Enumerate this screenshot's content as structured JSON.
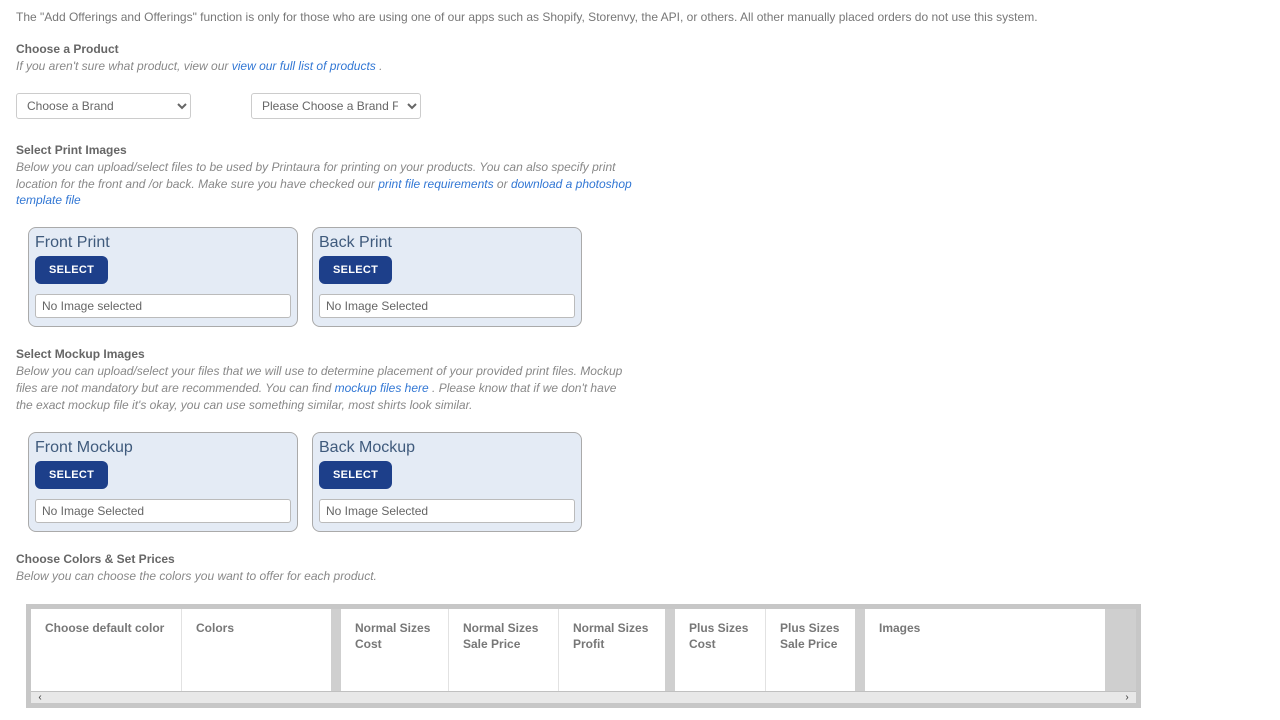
{
  "intro": "The \"Add Offerings and Offerings\" function is only for those who are using one of our apps such as Shopify, Storenvy, the API, or others. All other manually placed orders do not use this system.",
  "product": {
    "title": "Choose a Product",
    "sub_prefix": "If you aren't sure what product, view our ",
    "link": "view our full list of products",
    "sub_suffix": " ."
  },
  "selects": {
    "brand_placeholder": "Choose a Brand",
    "second_placeholder": "Please Choose a Brand First"
  },
  "print": {
    "title": "Select Print Images",
    "sub_a": "Below you can upload/select files to be used by Printaura for printing on your products. You can also specify print location for the front and /or back. Make sure you have checked our ",
    "link1": "print file requirements",
    "mid": " or ",
    "link2": "download a photoshop template file",
    "front_title": "Front Print",
    "back_title": "Back Print",
    "select_label": "SELECT",
    "front_status": "No Image selected",
    "back_status": "No Image Selected"
  },
  "mockup": {
    "title": "Select Mockup Images",
    "sub_a": "Below you can upload/select your files that we will use to determine placement of your provided print files. Mockup files are not mandatory but are recommended. You can find ",
    "link": "mockup files here",
    "sub_b": " . Please know that if we don't have the exact mockup file it's okay, you can use something similar, most shirts look similar.",
    "front_title": "Front Mockup",
    "back_title": "Back Mockup",
    "select_label": "SELECT",
    "front_status": "No Image Selected",
    "back_status": "No Image Selected"
  },
  "colors": {
    "title": "Choose Colors & Set Prices",
    "sub": "Below you can choose the colors you want to offer for each product."
  },
  "table": {
    "c1": "Choose default color",
    "c2": "Colors",
    "c3": "Normal Sizes Cost",
    "c4": "Normal Sizes Sale Price",
    "c5": "Normal Sizes Profit",
    "c6": "Plus Sizes Cost",
    "c7": "Plus Sizes Sale Price",
    "c8": "Images",
    "left_arrow": "‹",
    "right_arrow": "›"
  }
}
